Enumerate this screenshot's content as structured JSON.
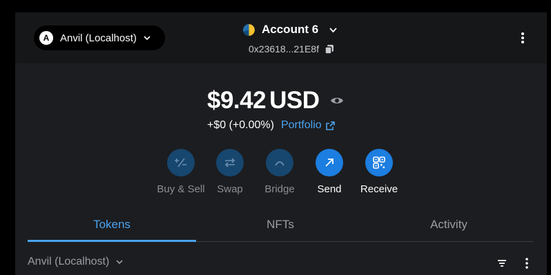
{
  "network": {
    "avatar_letter": "A",
    "label": "Anvil (Localhost)"
  },
  "account": {
    "name": "Account 6",
    "address": "0x23618...21E8f"
  },
  "balance": {
    "value": "$9.42",
    "currency": "USD",
    "change": "+$0 (+0.00%)",
    "portfolio_label": "Portfolio"
  },
  "actions": [
    {
      "label": "Buy & Sell",
      "icon": "buy-sell-icon",
      "enabled": false
    },
    {
      "label": "Swap",
      "icon": "swap-icon",
      "enabled": false
    },
    {
      "label": "Bridge",
      "icon": "bridge-icon",
      "enabled": false
    },
    {
      "label": "Send",
      "icon": "send-arrow-icon",
      "enabled": true
    },
    {
      "label": "Receive",
      "icon": "qr-code-icon",
      "enabled": true
    }
  ],
  "tabs": [
    {
      "label": "Tokens",
      "active": true
    },
    {
      "label": "NFTs",
      "active": false
    },
    {
      "label": "Activity",
      "active": false
    }
  ],
  "token_list": {
    "network_label": "Anvil (Localhost)"
  },
  "colors": {
    "accent": "#4aa3ef",
    "button_enabled": "#1c7ee0",
    "button_disabled": "#17466e",
    "background": "#1c1d20"
  }
}
